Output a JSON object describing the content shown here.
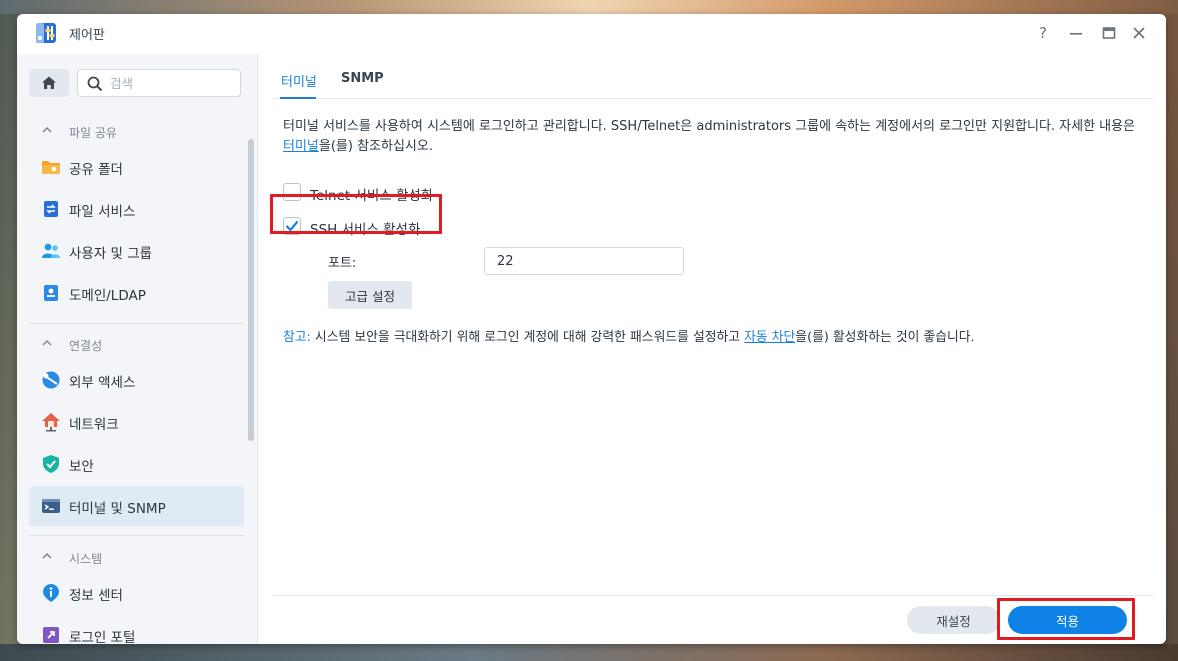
{
  "window": {
    "title": "제어판",
    "help_icon": "question-icon",
    "minimize_icon": "minimize-icon",
    "maximize_icon": "maximize-icon",
    "close_icon": "close-icon"
  },
  "sidebar": {
    "search_placeholder": "검색",
    "sections": [
      {
        "label": "파일 공유",
        "items": [
          {
            "label": "공유 폴더",
            "icon": "shared-folder-icon"
          },
          {
            "label": "파일 서비스",
            "icon": "file-services-icon"
          },
          {
            "label": "사용자 및 그룹",
            "icon": "users-groups-icon"
          },
          {
            "label": "도메인/LDAP",
            "icon": "domain-ldap-icon"
          }
        ]
      },
      {
        "label": "연결성",
        "items": [
          {
            "label": "외부 액세스",
            "icon": "external-access-icon"
          },
          {
            "label": "네트워크",
            "icon": "network-icon"
          },
          {
            "label": "보안",
            "icon": "security-shield-icon"
          },
          {
            "label": "터미널 및 SNMP",
            "icon": "terminal-icon",
            "active": true
          }
        ]
      },
      {
        "label": "시스템",
        "items": [
          {
            "label": "정보 센터",
            "icon": "info-icon"
          },
          {
            "label": "로그인 포털",
            "icon": "login-portal-icon"
          }
        ]
      }
    ]
  },
  "tabs": [
    {
      "label": "터미널",
      "active": true
    },
    {
      "label": "SNMP",
      "active": false
    }
  ],
  "terminal": {
    "description_part1": "터미널 서비스를 사용하여 시스템에 로그인하고 관리합니다. SSH/Telnet은 administrators 그룹에 속하는 계정에서의 로그인만 지원합니다. 자세한 내용은 ",
    "description_link": "터미널",
    "description_part2": "을(를) 참조하십시오.",
    "telnet_label": "Telnet 서비스 활성화",
    "telnet_checked": false,
    "ssh_label": "SSH 서비스 활성화",
    "ssh_checked": true,
    "port_label": "포트:",
    "port_value": "22",
    "advanced_button": "고급 설정",
    "note_prefix": "참고:",
    "note_part1": " 시스템 보안을 극대화하기 위해 로그인 계정에 대해 강력한 패스워드를 설정하고 ",
    "note_link": "자동 차단",
    "note_part2": "을(를) 활성화하는 것이 좋습니다."
  },
  "footer": {
    "reset_label": "재설정",
    "apply_label": "적용"
  },
  "colors": {
    "accent": "#1a80d9",
    "apply_bg": "#0e82e6",
    "highlight": "#e01b22",
    "active_item_bg": "#e0eaf5"
  }
}
